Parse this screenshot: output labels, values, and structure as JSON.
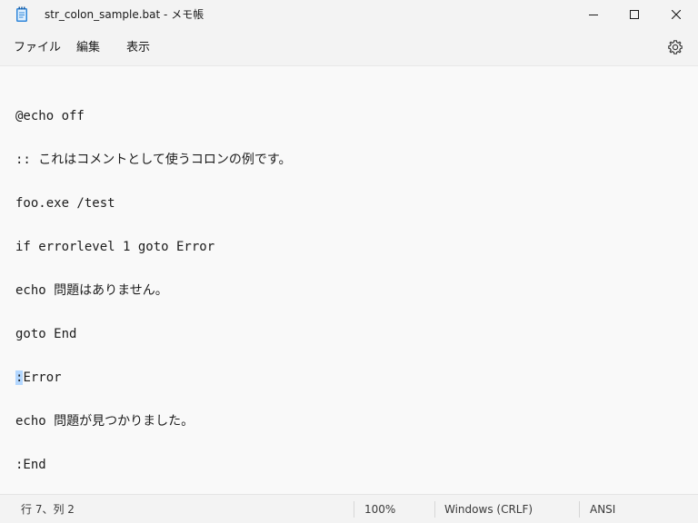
{
  "window": {
    "title": "str_colon_sample.bat - メモ帳",
    "icon": "notepad-icon"
  },
  "menu": {
    "file": "ファイル",
    "edit": "編集",
    "view": "表示"
  },
  "editor": {
    "lines": [
      "@echo off",
      ":: これはコメントとして使うコロンの例です。",
      "foo.exe /test",
      "if errorlevel 1 goto Error",
      "echo 問題はありません。",
      "goto End",
      ":Error",
      "echo 問題が見つかりました。",
      ":End"
    ],
    "selection": {
      "line": 7,
      "text": ":"
    },
    "selected_line_rest": "Error"
  },
  "status": {
    "position": "行 7、列 2",
    "zoom": "100%",
    "line_ending": "Windows (CRLF)",
    "encoding": "ANSI"
  },
  "colors": {
    "selection": "#b3d7ff",
    "background": "#f9f9f9",
    "chrome": "#f3f3f3"
  }
}
